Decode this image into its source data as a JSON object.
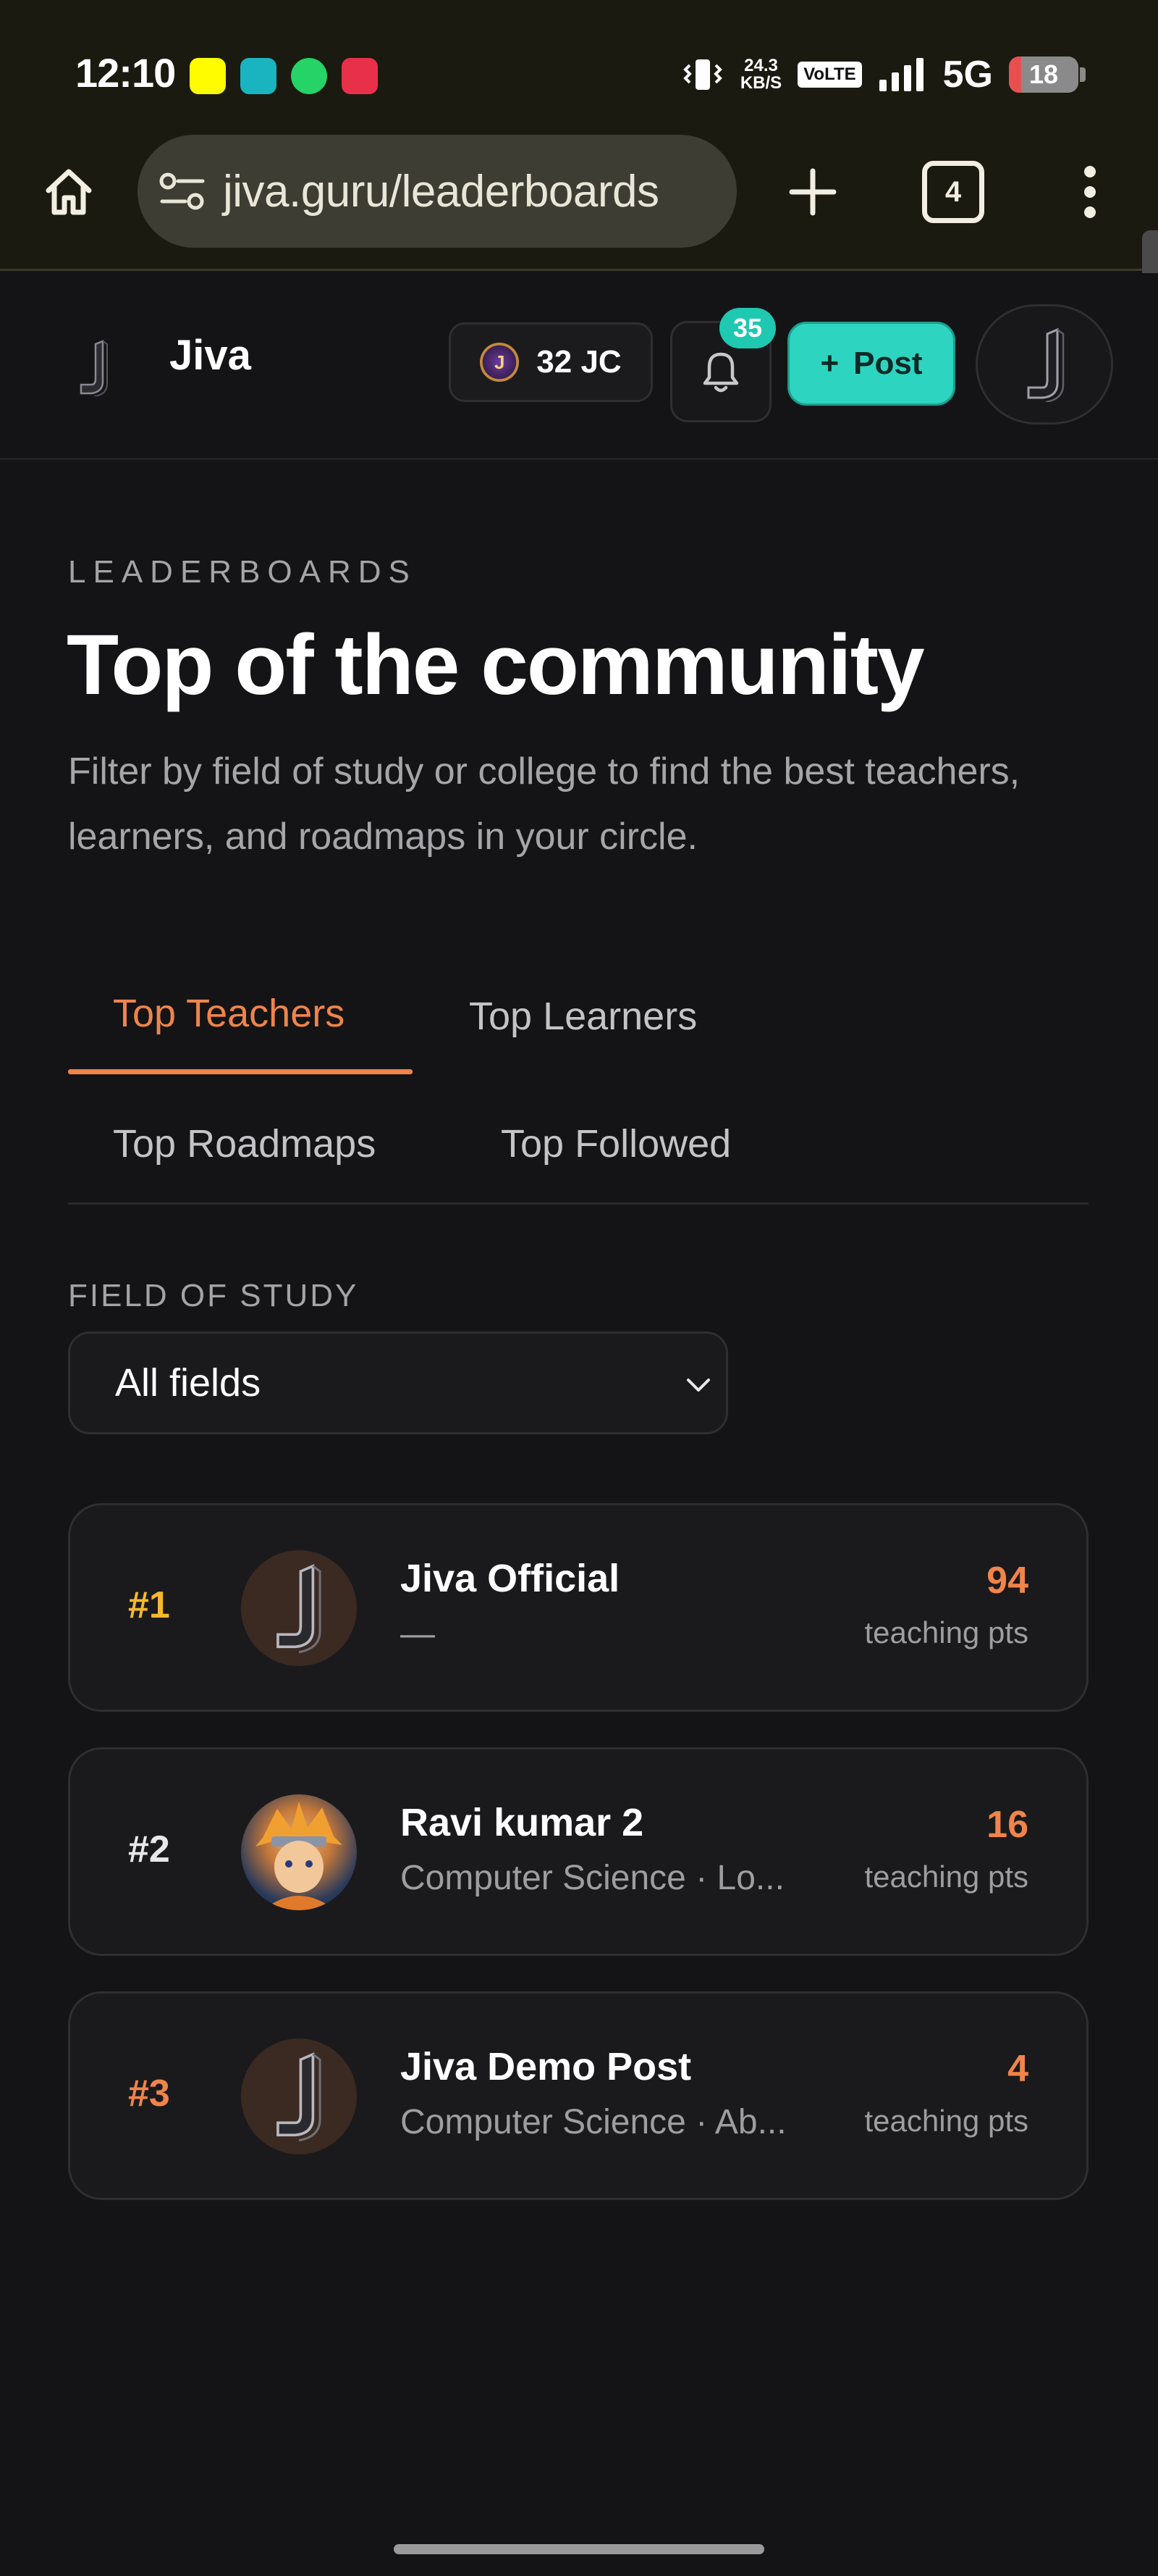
{
  "status_bar": {
    "time": "12:10",
    "speed_value": "24.3",
    "speed_unit": "KB/S",
    "volte": "VoLTE",
    "network": "5G",
    "battery": "18",
    "battery_level_pct": 18
  },
  "browser": {
    "url": "jiva.guru/leaderboards",
    "tab_count": "4"
  },
  "header": {
    "brand": "Jiva",
    "coins": "32 JC",
    "notification_count": "35",
    "post_label": "Post"
  },
  "hero": {
    "eyebrow": "LEADERBOARDS",
    "title": "Top of the community",
    "subtitle": "Filter by field of study or college to find the best teachers, learners, and roadmaps in your circle."
  },
  "tabs": [
    {
      "label": "Top Teachers",
      "active": true
    },
    {
      "label": "Top Learners",
      "active": false
    },
    {
      "label": "Top Roadmaps",
      "active": false
    },
    {
      "label": "Top Followed",
      "active": false
    }
  ],
  "filter": {
    "label": "FIELD OF STUDY",
    "selected": "All fields"
  },
  "leaderboard": [
    {
      "rank": "#1",
      "name": "Jiva Official",
      "meta": "—",
      "points": "94",
      "points_label": "teaching pts",
      "rank_color": "#f5b82e",
      "avatar": "jiva-logo"
    },
    {
      "rank": "#2",
      "name": "Ravi kumar 2",
      "meta": "Computer Science · Lo...",
      "points": "16",
      "points_label": "teaching pts",
      "rank_color": "#e8e8ea",
      "avatar": "anime-avatar"
    },
    {
      "rank": "#3",
      "name": "Jiva Demo Post",
      "meta": "Computer Science · Ab...",
      "points": "4",
      "points_label": "teaching pts",
      "rank_color": "#f0844a",
      "avatar": "jiva-logo"
    }
  ],
  "colors": {
    "accent": "#f0844a",
    "teal": "#2dd4bf",
    "background": "#141416"
  }
}
